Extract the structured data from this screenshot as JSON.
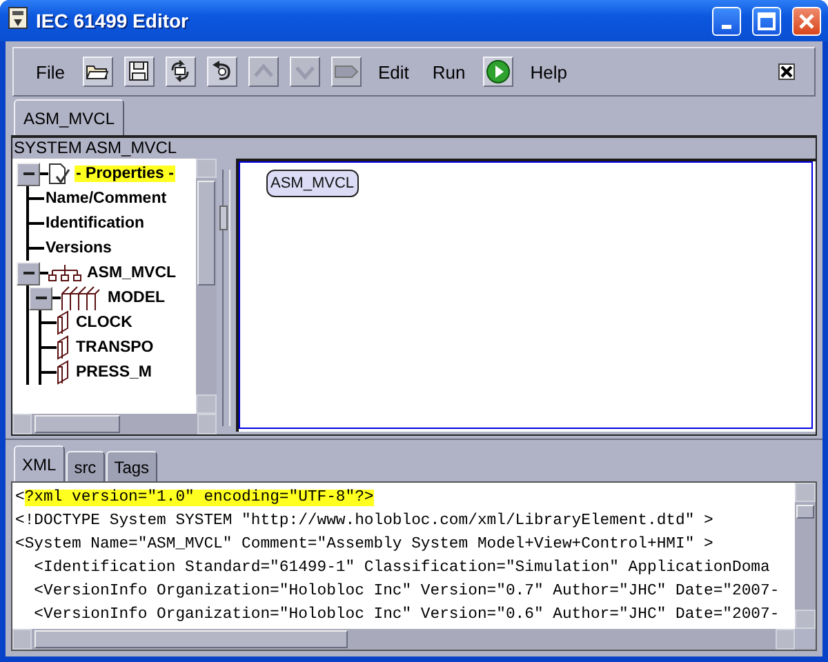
{
  "window": {
    "title": "IEC 61499 Editor"
  },
  "toolbar": [
    {
      "kind": "menu",
      "label": "File",
      "disabled": false
    },
    {
      "kind": "open",
      "disabled": false
    },
    {
      "kind": "save",
      "disabled": false
    },
    {
      "kind": "sync",
      "disabled": false
    },
    {
      "kind": "revert",
      "disabled": false
    },
    {
      "kind": "up",
      "disabled": true
    },
    {
      "kind": "down",
      "disabled": true
    },
    {
      "kind": "tag",
      "disabled": true
    },
    {
      "kind": "menu",
      "label": "Edit",
      "disabled": false
    },
    {
      "kind": "menu",
      "label": "Run",
      "disabled": false
    },
    {
      "kind": "play",
      "disabled": false
    },
    {
      "kind": "menu",
      "label": "Help",
      "disabled": false
    }
  ],
  "tabs": [
    {
      "label": "ASM_MVCL",
      "selected": true
    }
  ],
  "panel_title": "SYSTEM ASM_MVCL",
  "tree": [
    {
      "label": "- Properties -",
      "kind": "properties",
      "expanded": true,
      "selected": true,
      "children": [
        {
          "label": "Name/Comment",
          "kind": "leaf",
          "selected": false
        },
        {
          "label": "Identification",
          "kind": "leaf",
          "selected": false
        },
        {
          "label": "Versions",
          "kind": "leaf",
          "selected": false
        }
      ]
    },
    {
      "label": "ASM_MVCL",
      "kind": "system",
      "expanded": true,
      "selected": false,
      "children": [
        {
          "label": "MODEL",
          "kind": "device",
          "expanded": true,
          "selected": false,
          "children": [
            {
              "label": "CLOCK",
              "kind": "resource",
              "selected": false
            },
            {
              "label": "TRANSPO",
              "kind": "resource",
              "selected": false
            },
            {
              "label": "PRESS_M",
              "kind": "resource",
              "selected": false
            }
          ]
        }
      ]
    }
  ],
  "canvas": {
    "nodes": [
      {
        "label": "ASM_MVCL"
      }
    ]
  },
  "bottom_tabs": [
    {
      "label": "XML",
      "selected": true
    },
    {
      "label": "src",
      "selected": false
    },
    {
      "label": "Tags",
      "selected": false
    }
  ],
  "xml_lines": [
    {
      "text": "<",
      "highlighted": "?xml version=\"1.0\" encoding=\"UTF-8\"?>"
    },
    {
      "text": "<!DOCTYPE System SYSTEM \"http://www.holobloc.com/xml/LibraryElement.dtd\" >"
    },
    {
      "text": "<System Name=\"ASM_MVCL\" Comment=\"Assembly System Model+View+Control+HMI\" >"
    },
    {
      "text": "  <Identification Standard=\"61499-1\" Classification=\"Simulation\" ApplicationDoma"
    },
    {
      "text": "  <VersionInfo Organization=\"Holobloc Inc\" Version=\"0.7\" Author=\"JHC\" Date=\"2007-"
    },
    {
      "text": "  <VersionInfo Organization=\"Holobloc Inc\" Version=\"0.6\" Author=\"JHC\" Date=\"2007-"
    }
  ]
}
